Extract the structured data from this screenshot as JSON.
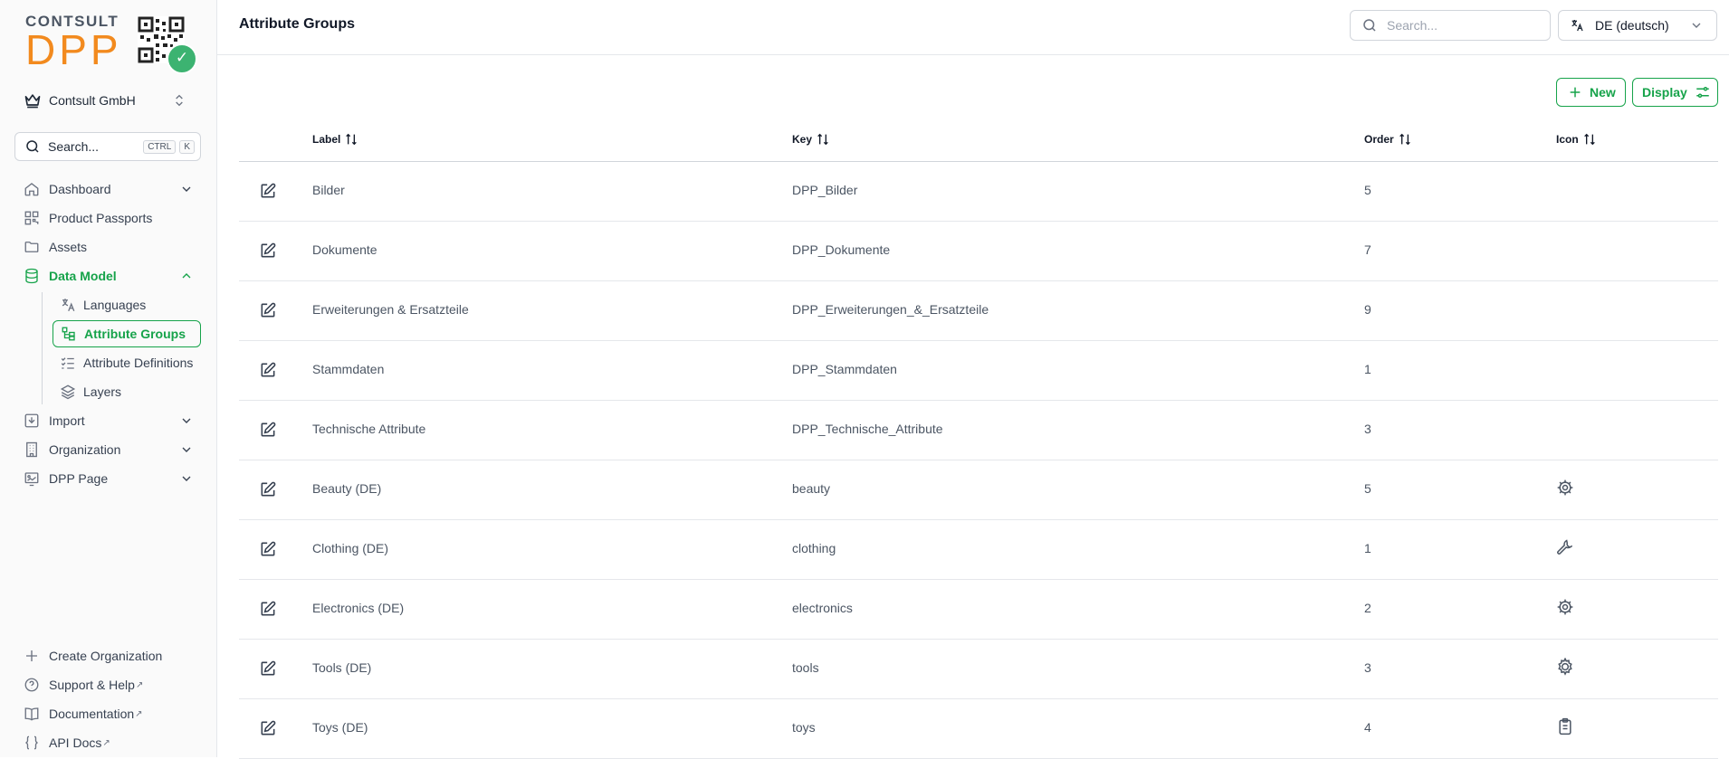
{
  "brand": {
    "top": "CONTSULT",
    "bottom": "DPP",
    "accent": "#f28a1e",
    "check": "✓"
  },
  "sidebar": {
    "org_name": "Contsult GmbH",
    "search_label": "Search...",
    "kbd_ctrl": "CTRL",
    "kbd_k": "K",
    "items": [
      {
        "label": "Dashboard",
        "icon": "home-icon"
      },
      {
        "label": "Product Passports",
        "icon": "qr-icon"
      },
      {
        "label": "Assets",
        "icon": "folder-icon"
      },
      {
        "label": "Data Model",
        "icon": "database-icon",
        "active": true
      },
      {
        "label": "Import",
        "icon": "import-icon"
      },
      {
        "label": "Organization",
        "icon": "building-icon"
      },
      {
        "label": "DPP Page",
        "icon": "page-icon"
      }
    ],
    "subitems": [
      {
        "label": "Languages",
        "icon": "translate-icon"
      },
      {
        "label": "Attribute Groups",
        "icon": "groups-icon",
        "selected": true
      },
      {
        "label": "Attribute Definitions",
        "icon": "list-check-icon"
      },
      {
        "label": "Layers",
        "icon": "layers-icon"
      }
    ],
    "bottom": [
      {
        "label": "Create Organization",
        "icon": "plus-icon",
        "external": false
      },
      {
        "label": "Support & Help",
        "icon": "help-icon",
        "external": true
      },
      {
        "label": "Documentation",
        "icon": "book-icon",
        "external": true
      },
      {
        "label": "API Docs",
        "icon": "braces-icon",
        "external": true
      }
    ],
    "external_mark": "↗"
  },
  "header": {
    "title": "Attribute Groups",
    "search_placeholder": "Search...",
    "language": "DE (deutsch)"
  },
  "toolbar": {
    "new_label": "New",
    "display_label": "Display"
  },
  "table": {
    "columns": {
      "label": "Label",
      "key": "Key",
      "order": "Order",
      "icon": "Icon"
    },
    "rows": [
      {
        "label": "Bilder",
        "key": "DPP_Bilder",
        "order": "5",
        "icon": ""
      },
      {
        "label": "Dokumente",
        "key": "DPP_Dokumente",
        "order": "7",
        "icon": ""
      },
      {
        "label": "Erweiterungen & Ersatzteile",
        "key": "DPP_Erweiterungen_&_Ersatzteile",
        "order": "9",
        "icon": ""
      },
      {
        "label": "Stammdaten",
        "key": "DPP_Stammdaten",
        "order": "1",
        "icon": ""
      },
      {
        "label": "Technische Attribute",
        "key": "DPP_Technische_Attribute",
        "order": "3",
        "icon": ""
      },
      {
        "label": "Beauty (DE)",
        "key": "beauty",
        "order": "5",
        "icon": "gear-icon"
      },
      {
        "label": "Clothing (DE)",
        "key": "clothing",
        "order": "1",
        "icon": "wrench-icon"
      },
      {
        "label": "Electronics (DE)",
        "key": "electronics",
        "order": "2",
        "icon": "gear-icon"
      },
      {
        "label": "Tools (DE)",
        "key": "tools",
        "order": "3",
        "icon": "cog-icon"
      },
      {
        "label": "Toys (DE)",
        "key": "toys",
        "order": "4",
        "icon": "clipboard-icon"
      }
    ]
  },
  "colors": {
    "primary": "#16a34a",
    "text": "#1f2937",
    "muted": "#4b5563",
    "border": "#e5e7eb"
  }
}
